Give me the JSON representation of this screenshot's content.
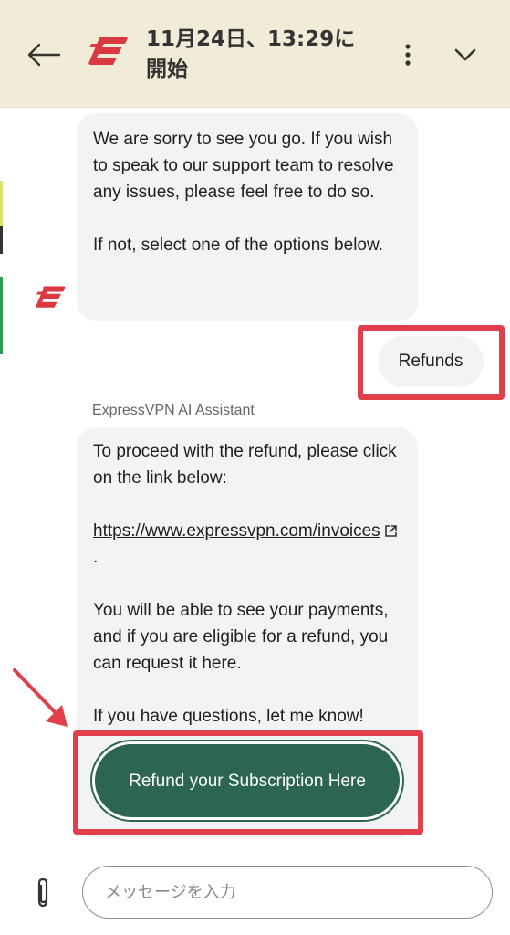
{
  "header": {
    "title": "11月24日、13:29に開始",
    "back_icon": "arrow-left-icon",
    "more_icon": "more-vertical-icon",
    "collapse_icon": "chevron-down-icon",
    "logo": "expressvpn-logo",
    "background": "#f0ecd8"
  },
  "messages": {
    "bot_message_1": {
      "line1": "We are sorry to see you go. If you wish to speak to our support team to resolve any issues, please feel free to do so.",
      "line2": "If not, select one of the options below."
    },
    "user_choice": "Refunds",
    "sender_name": "ExpressVPN AI Assistant",
    "bot_message_2": {
      "intro": "To proceed with the refund, please click on the link below:",
      "link_text": "https://www.expressvpn.com/invoices",
      "link_suffix": ".",
      "body": "You will be able to see your payments, and if you are eligible for a refund, you can request it here.",
      "closing": "If you have questions, let me know!"
    },
    "refund_button": "Refund your Subscription Here"
  },
  "footer": {
    "attach_icon": "paperclip-icon",
    "input_placeholder": "メッセージを入力",
    "input_value": ""
  },
  "colors": {
    "brand_red": "#da3940",
    "button_green": "#2c6650",
    "highlight_red": "#e0404a",
    "bubble_bg": "#f2f3f5"
  }
}
